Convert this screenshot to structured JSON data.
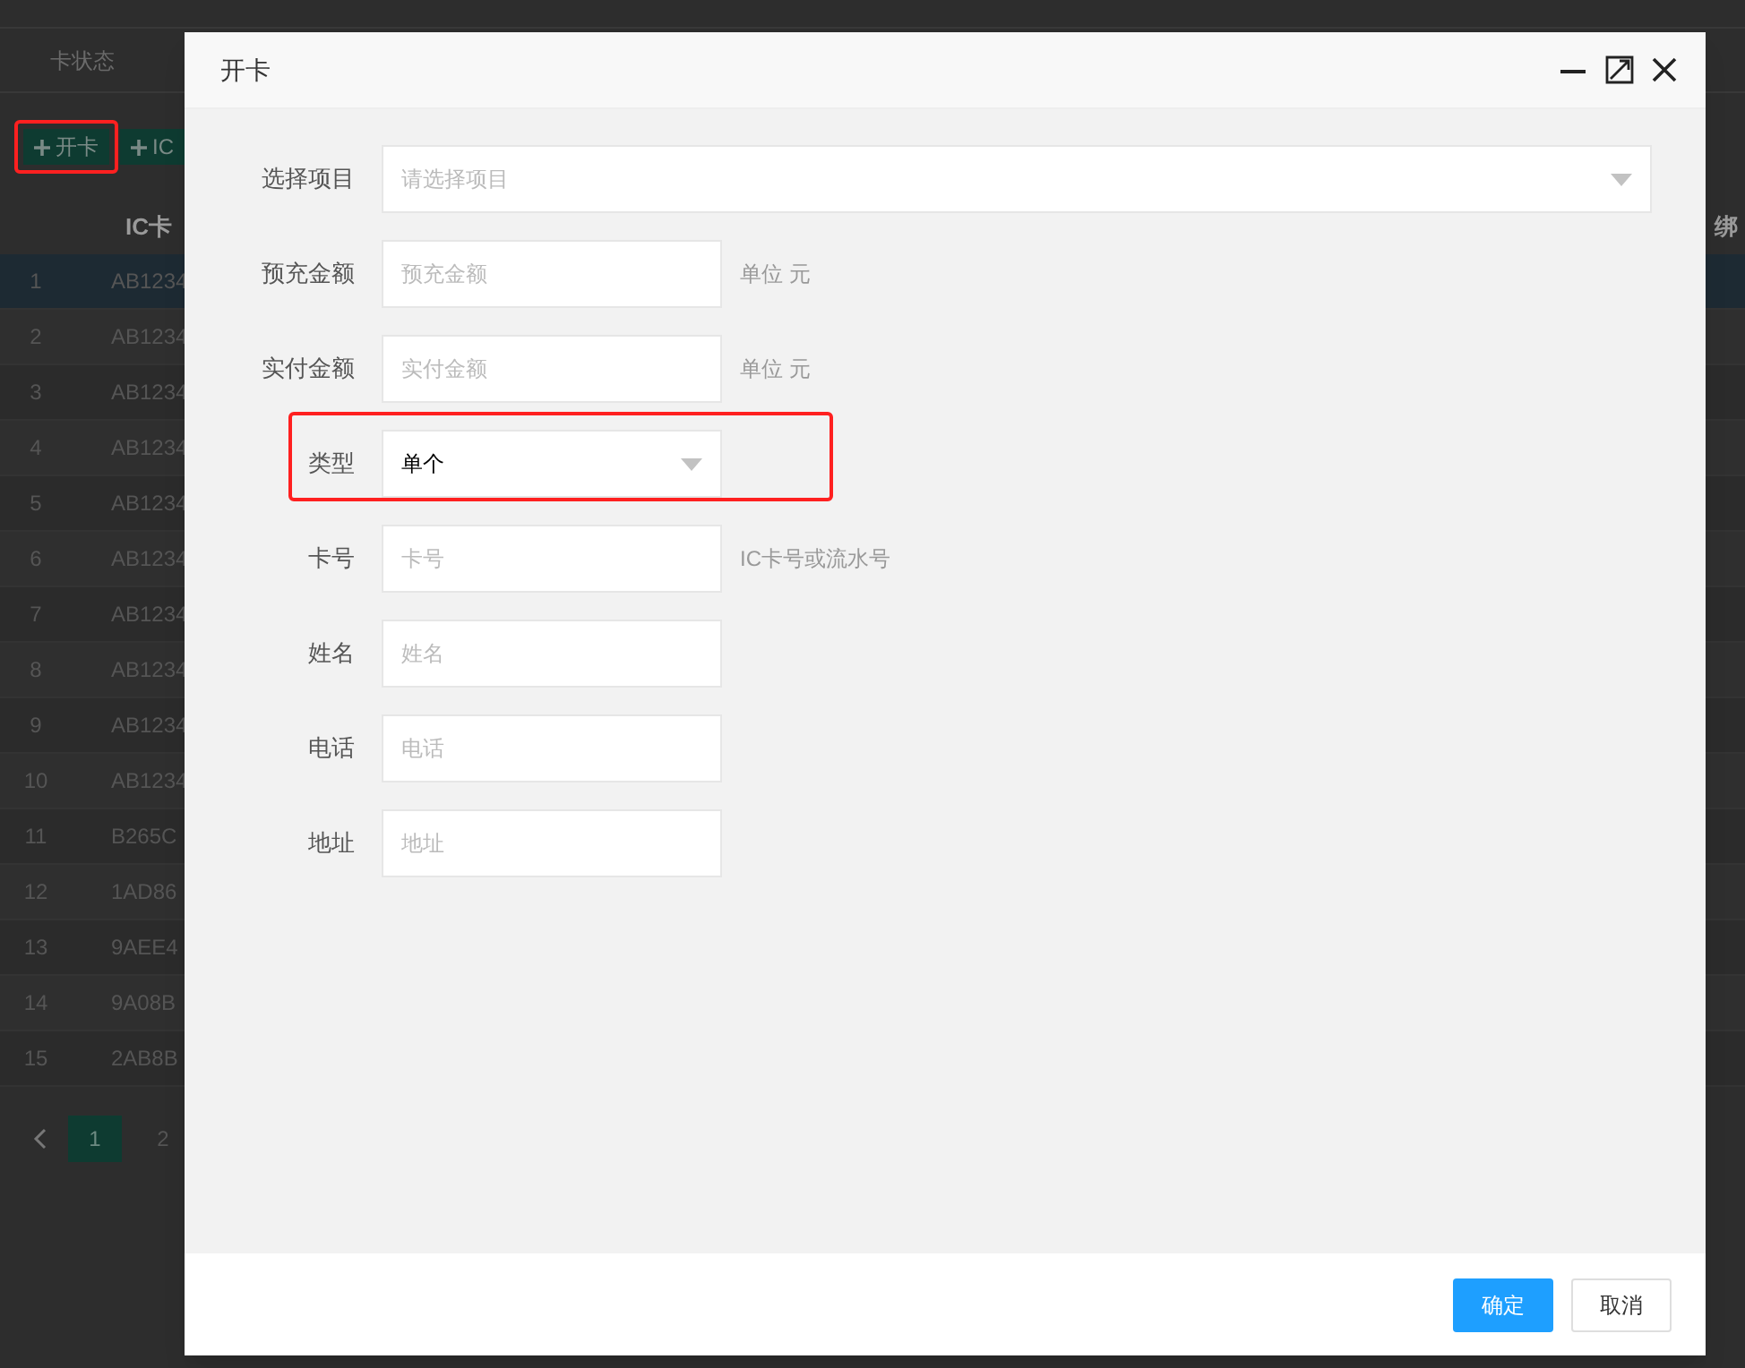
{
  "background": {
    "tab": "卡状态",
    "buttons": [
      {
        "label": "开卡",
        "highlighted": true
      },
      {
        "label": "IC",
        "highlighted": false
      }
    ],
    "columns": [
      "IC卡",
      "绑"
    ],
    "rows": [
      {
        "index": "1",
        "card": "AB1234",
        "selected": true
      },
      {
        "index": "2",
        "card": "AB1234",
        "selected": false
      },
      {
        "index": "3",
        "card": "AB1234",
        "selected": false
      },
      {
        "index": "4",
        "card": "AB1234",
        "selected": false
      },
      {
        "index": "5",
        "card": "AB1234",
        "selected": false
      },
      {
        "index": "6",
        "card": "AB1234",
        "selected": false
      },
      {
        "index": "7",
        "card": "AB1234",
        "selected": false
      },
      {
        "index": "8",
        "card": "AB1234",
        "selected": false
      },
      {
        "index": "9",
        "card": "AB1234",
        "selected": false
      },
      {
        "index": "10",
        "card": "AB1234",
        "selected": false
      },
      {
        "index": "11",
        "card": "B265C",
        "selected": false
      },
      {
        "index": "12",
        "card": "1AD86",
        "selected": false
      },
      {
        "index": "13",
        "card": "9AEE4",
        "selected": false
      },
      {
        "index": "14",
        "card": "9A08B",
        "selected": false
      },
      {
        "index": "15",
        "card": "2AB8B",
        "selected": false
      }
    ],
    "pages": [
      {
        "label": "1",
        "selected": true
      },
      {
        "label": "2",
        "selected": false
      }
    ]
  },
  "dialog": {
    "title": "开卡",
    "fields": [
      {
        "kind": "select",
        "label": "选择项目",
        "placeholder": "请选择项目",
        "wide": true,
        "highlighted": false
      },
      {
        "kind": "input",
        "label": "预充金额",
        "placeholder": "预充金额",
        "hint": "单位 元",
        "highlighted": false
      },
      {
        "kind": "input",
        "label": "实付金额",
        "placeholder": "实付金额",
        "hint": "单位 元",
        "highlighted": false
      },
      {
        "kind": "select",
        "label": "类型",
        "value": "单个",
        "highlighted": true
      },
      {
        "kind": "input",
        "label": "卡号",
        "placeholder": "卡号",
        "hint": "IC卡号或流水号",
        "highlighted": false
      },
      {
        "kind": "input",
        "label": "姓名",
        "placeholder": "姓名",
        "highlighted": false
      },
      {
        "kind": "input",
        "label": "电话",
        "placeholder": "电话",
        "highlighted": false
      },
      {
        "kind": "input",
        "label": "地址",
        "placeholder": "地址",
        "highlighted": false
      }
    ],
    "buttons": [
      {
        "kind": "primary",
        "label": "确定"
      },
      {
        "kind": "default",
        "label": "取消"
      }
    ]
  }
}
